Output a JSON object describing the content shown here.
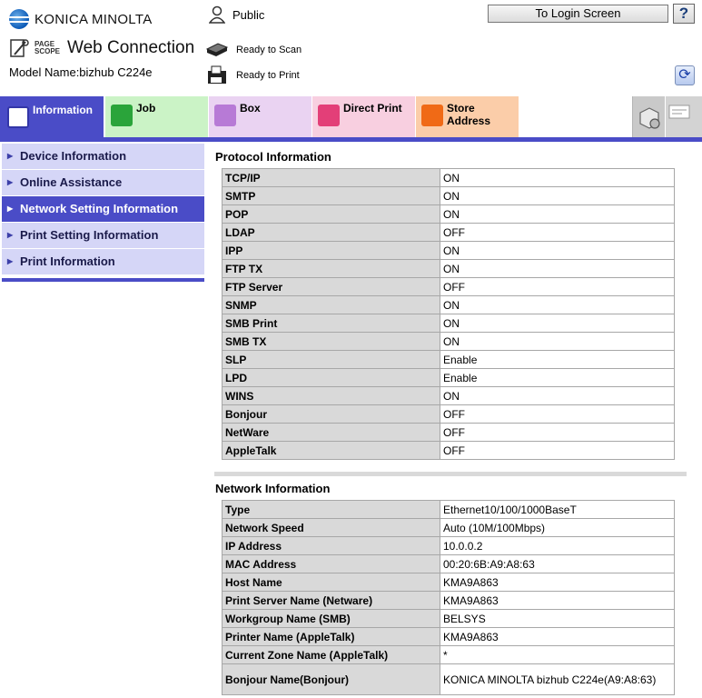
{
  "header": {
    "brand": "KONICA MINOLTA",
    "pagescope_top": "PAGE",
    "pagescope_bottom": "SCOPE",
    "app_title": "Web Connection",
    "model": "Model Name:bizhub C224e",
    "user": "Public",
    "scan_status": "Ready to Scan",
    "print_status": "Ready to Print",
    "login_button": "To Login Screen",
    "help_button": "?"
  },
  "tabs": [
    {
      "label": "Information",
      "color": "#4a4cc7"
    },
    {
      "label": "Job",
      "color": "#cbf3c6"
    },
    {
      "label": "Box",
      "color": "#ead3f2"
    },
    {
      "label": "Direct Print",
      "color": "#f8cfe0"
    },
    {
      "label": "Store Address",
      "color": "#fbcda9"
    }
  ],
  "sidebar": {
    "items": [
      {
        "label": "Device Information",
        "active": false
      },
      {
        "label": "Online Assistance",
        "active": false
      },
      {
        "label": "Network Setting Information",
        "active": true
      },
      {
        "label": "Print Setting Information",
        "active": false
      },
      {
        "label": "Print Information",
        "active": false
      }
    ]
  },
  "protocol": {
    "title": "Protocol Information",
    "rows": [
      {
        "name": "TCP/IP",
        "value": "ON"
      },
      {
        "name": "SMTP",
        "value": "ON"
      },
      {
        "name": "POP",
        "value": "ON"
      },
      {
        "name": "LDAP",
        "value": "OFF"
      },
      {
        "name": "IPP",
        "value": "ON"
      },
      {
        "name": "FTP TX",
        "value": "ON"
      },
      {
        "name": "FTP Server",
        "value": "OFF"
      },
      {
        "name": "SNMP",
        "value": "ON"
      },
      {
        "name": "SMB Print",
        "value": "ON"
      },
      {
        "name": "SMB TX",
        "value": "ON"
      },
      {
        "name": "SLP",
        "value": "Enable"
      },
      {
        "name": "LPD",
        "value": "Enable"
      },
      {
        "name": "WINS",
        "value": "ON"
      },
      {
        "name": "Bonjour",
        "value": "OFF"
      },
      {
        "name": "NetWare",
        "value": "OFF"
      },
      {
        "name": "AppleTalk",
        "value": "OFF"
      }
    ]
  },
  "network": {
    "title": "Network Information",
    "rows": [
      {
        "name": "Type",
        "value": "Ethernet10/100/1000BaseT"
      },
      {
        "name": "Network Speed",
        "value": "Auto (10M/100Mbps)"
      },
      {
        "name": "IP Address",
        "value": "10.0.0.2"
      },
      {
        "name": "MAC Address",
        "value": "00:20:6B:A9:A8:63"
      },
      {
        "name": "Host Name",
        "value": "KMA9A863"
      },
      {
        "name": "Print Server Name (Netware)",
        "value": "KMA9A863"
      },
      {
        "name": "Workgroup Name (SMB)",
        "value": "BELSYS"
      },
      {
        "name": "Printer Name (AppleTalk)",
        "value": "KMA9A863"
      },
      {
        "name": "Current Zone Name (AppleTalk)",
        "value": "*"
      },
      {
        "name": "Bonjour Name(Bonjour)",
        "value": "KONICA MINOLTA bizhub C224e(A9:A8:63)"
      }
    ]
  }
}
